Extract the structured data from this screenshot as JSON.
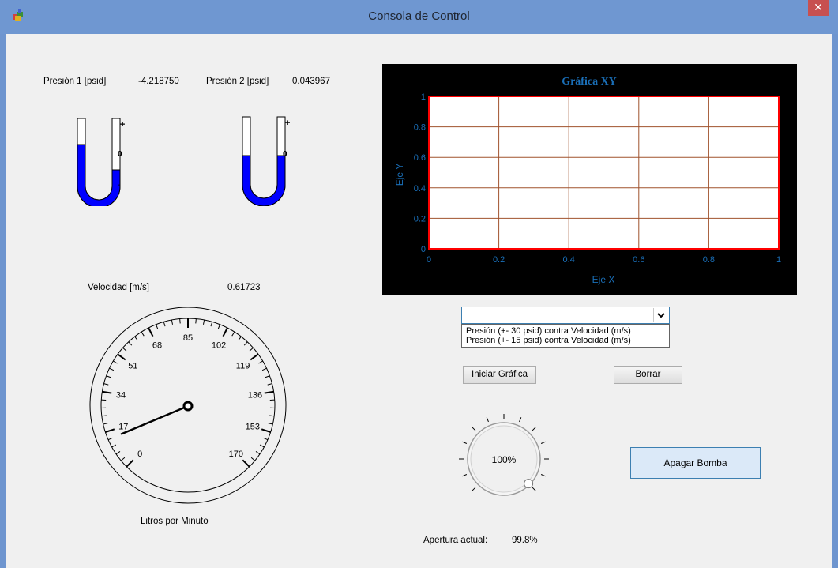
{
  "window": {
    "title": "Consola de Control",
    "close_glyph": "✕",
    "icon": "app-icon"
  },
  "pressure1": {
    "label": "Presión 1 [psid]",
    "value": "-4.218750",
    "fill": -0.4
  },
  "pressure2": {
    "label": "Presión 2 [psid]",
    "value": "0.043967",
    "fill": 0.0
  },
  "manometer_marks": {
    "plus": "+",
    "zero": "0",
    "minus": "-"
  },
  "velocity": {
    "label": "Velocidad [m/s]",
    "value": "0.61723"
  },
  "gauge": {
    "label": "Litros por Minuto",
    "ticks": [
      "0",
      "17",
      "34",
      "51",
      "68",
      "85",
      "102",
      "119",
      "136",
      "153",
      "170"
    ],
    "min": 0,
    "max": 170,
    "needle_value": 14
  },
  "chart_data": {
    "type": "line",
    "title": "Gráfica XY",
    "xlabel": "Eje X",
    "ylabel": "Eje Y",
    "xlim": [
      0,
      1
    ],
    "ylim": [
      0,
      1
    ],
    "xticks": [
      "0",
      "0.2",
      "0.4",
      "0.6",
      "0.8",
      "1"
    ],
    "yticks": [
      "0",
      "0.2",
      "0.4",
      "0.6",
      "0.8",
      "1"
    ],
    "grid": true,
    "series": [],
    "colors": {
      "background": "#000000",
      "plot_area": "#ffffff",
      "border": "#ff0000",
      "grid": "#a0522d",
      "text": "#1a6fb8"
    }
  },
  "combo": {
    "value": "",
    "options": [
      "Presión (+- 30 psid) contra Velocidad (m/s)",
      "Presión (+- 15 psid) contra Velocidad (m/s)"
    ]
  },
  "buttons": {
    "start": "Iniciar Gráfica",
    "clear": "Borrar",
    "pump": "Apagar Bomba"
  },
  "knob": {
    "value": "100%",
    "level": 1.0
  },
  "aperture": {
    "label": "Apertura actual:",
    "value": "99.8%"
  },
  "colors": {
    "fluid": "#0000ff",
    "accent": "#3c7fb1"
  }
}
